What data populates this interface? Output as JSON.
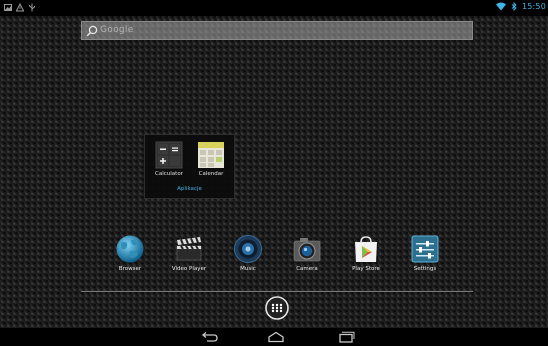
{
  "status_bar": {
    "clock": "15:50",
    "icons": [
      "image-notification-icon",
      "warning-notification-icon",
      "usb-icon",
      "wifi-icon",
      "bluetooth-icon"
    ]
  },
  "search": {
    "placeholder": "Google"
  },
  "folder": {
    "name": "Aplikacje",
    "apps": [
      {
        "label": "Calculator",
        "icon": "calculator-icon"
      },
      {
        "label": "Calendar",
        "icon": "calendar-icon"
      }
    ]
  },
  "dock": {
    "apps": [
      {
        "label": "Browser",
        "icon": "browser-globe-icon"
      },
      {
        "label": "Video Player",
        "icon": "clapperboard-icon"
      },
      {
        "label": "Music",
        "icon": "speaker-icon"
      },
      {
        "label": "Camera",
        "icon": "camera-icon"
      },
      {
        "label": "Play Store",
        "icon": "play-store-icon"
      },
      {
        "label": "Settings",
        "icon": "settings-sliders-icon"
      }
    ]
  },
  "nav": {
    "buttons": [
      "back-icon",
      "home-icon",
      "recent-apps-icon"
    ]
  },
  "colors": {
    "accent": "#3fb4e8",
    "status_bar": "#000000",
    "wallpaper": "#1a1a1a"
  }
}
